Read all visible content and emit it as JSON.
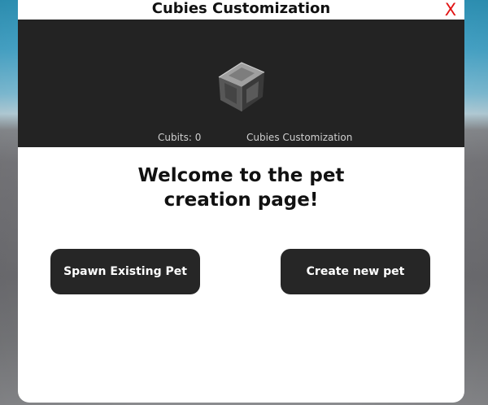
{
  "window": {
    "title": "Cubies Customization",
    "close_label": "X"
  },
  "banner": {
    "icon": "cube-icon",
    "cubits_text": "Cubits: 0",
    "subtitle": "Cubies Customization"
  },
  "main": {
    "heading_line1": "Welcome to the pet",
    "heading_line2": "creation page!"
  },
  "actions": {
    "spawn_label": "Spawn Existing Pet",
    "create_label": "Create new pet"
  },
  "colors": {
    "close": "#e21414",
    "banner_bg": "#232323",
    "button_bg": "#262626",
    "dialog_bg": "#ffffff"
  }
}
